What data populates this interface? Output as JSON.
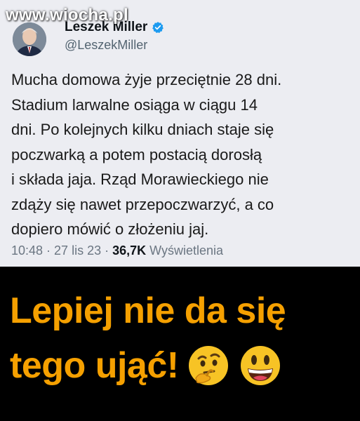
{
  "watermark": "www.wiocha.pl",
  "tweet": {
    "author_name": "Leszek Miller",
    "handle": "@LeszekMiller",
    "text_lines": [
      "Mucha domowa żyje przeciętnie 28 dni.",
      "Stadium larwalne osiąga w ciągu 14",
      "dni. Po kolejnych kilku dniach staje się",
      "poczwarką a potem postacią dorosłą",
      "i składa jaja. Rząd Morawieckiego nie",
      "zdąży się nawet przepoczwarzyć, a co",
      "dopiero mówić o złożeniu jaj."
    ],
    "time": "10:48",
    "date": "27 lis 23",
    "views_count": "36,7K",
    "views_label": "Wyświetlenia",
    "separator": "·",
    "verified_color": "#1d9bf0"
  },
  "caption": {
    "line1": "Lepiej nie da się",
    "line2": "tego ująć!",
    "color": "#f5a000",
    "emojis": [
      "thinking-face-icon",
      "grinning-face-icon"
    ]
  }
}
